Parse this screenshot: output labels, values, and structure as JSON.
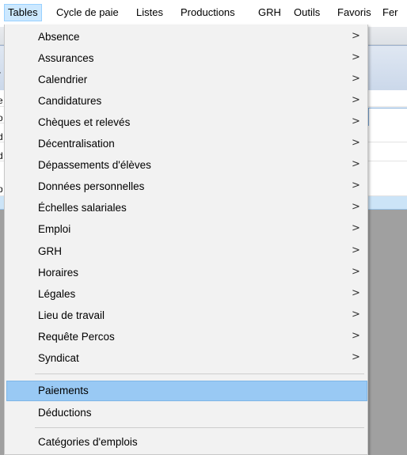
{
  "menubar": {
    "items": [
      {
        "label": "Tables",
        "active": true
      },
      {
        "label": "Cycle de paie"
      },
      {
        "label": "Listes"
      },
      {
        "label": "Productions"
      },
      {
        "label": "GRH"
      },
      {
        "label": "Outils"
      },
      {
        "label": "Favoris"
      },
      {
        "label": "Fer"
      }
    ]
  },
  "menu": {
    "submenu_items": [
      {
        "label": "Absence",
        "arrow": ">"
      },
      {
        "label": "Assurances",
        "arrow": ">"
      },
      {
        "label": "Calendrier",
        "arrow": ">"
      },
      {
        "label": "Candidatures",
        "arrow": ">"
      },
      {
        "label": "Chèques et relevés",
        "arrow": ">"
      },
      {
        "label": "Décentralisation",
        "arrow": ">"
      },
      {
        "label": "Dépassements d'élèves",
        "arrow": ">"
      },
      {
        "label": "Données personnelles",
        "arrow": ">"
      },
      {
        "label": "Échelles salariales",
        "arrow": ">"
      },
      {
        "label": "Emploi",
        "arrow": ">"
      },
      {
        "label": "GRH",
        "arrow": ">"
      },
      {
        "label": "Horaires",
        "arrow": ">"
      },
      {
        "label": "Légales",
        "arrow": ">"
      },
      {
        "label": "Lieu de travail",
        "arrow": ">"
      },
      {
        "label": "Requête Percos",
        "arrow": ">"
      },
      {
        "label": "Syndicat",
        "arrow": ">"
      }
    ],
    "highlighted_item": {
      "label": "Paiements"
    },
    "deductions_item": {
      "label": "Déductions"
    },
    "categories_item": {
      "label": "Catégories d'emplois"
    }
  },
  "background": {
    "edge_chars": [
      "r",
      "e",
      "o",
      "d",
      "d",
      "p"
    ]
  },
  "colors": {
    "highlight": "#99c9f4",
    "menu_background": "#f2f2f2",
    "active_menubar": "#cce8ff"
  }
}
